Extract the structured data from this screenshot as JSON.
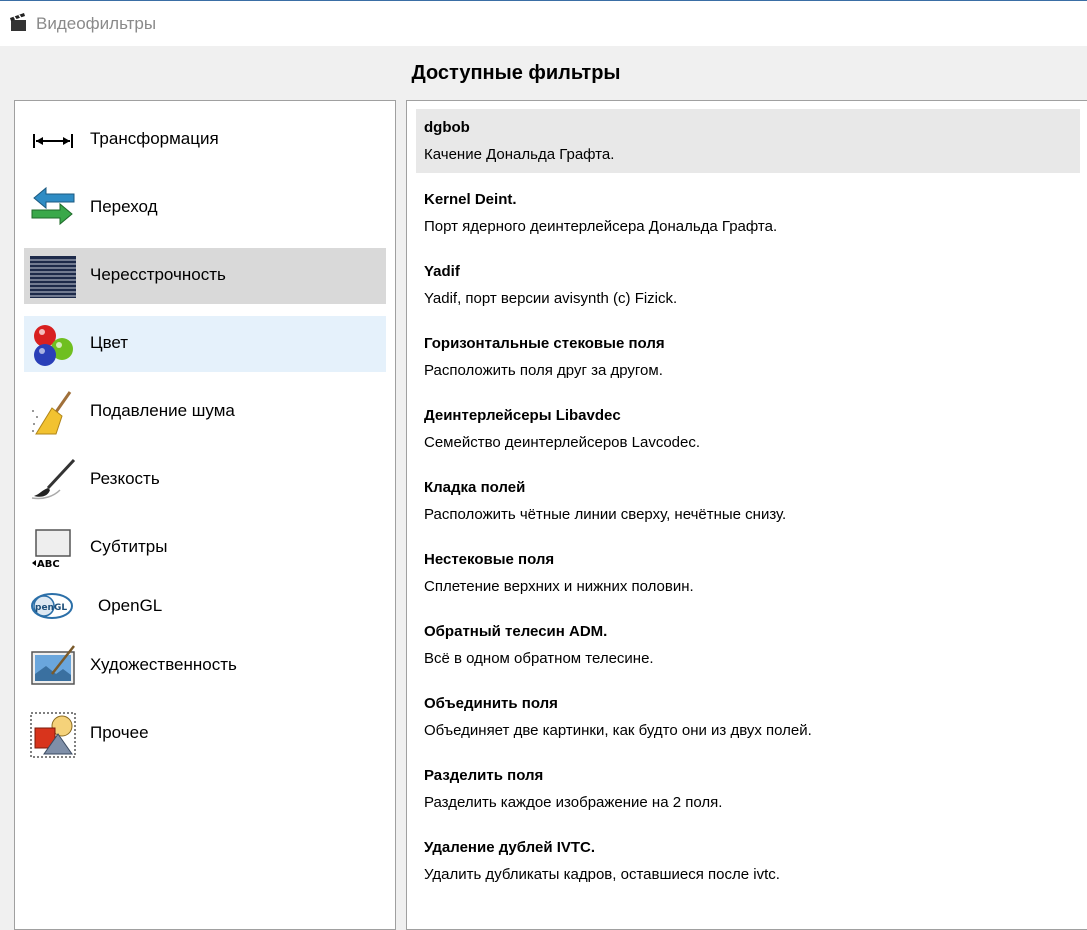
{
  "window": {
    "title": "Видеофильтры"
  },
  "heading": "Доступные фильтры",
  "categories": [
    {
      "label": "Трансформация",
      "icon": "transform-icon"
    },
    {
      "label": "Переход",
      "icon": "transition-arrows-icon"
    },
    {
      "label": "Чересстрочность",
      "icon": "interlace-lines-icon",
      "state": "selected"
    },
    {
      "label": "Цвет",
      "icon": "color-balls-icon",
      "state": "hover"
    },
    {
      "label": "Подавление шума",
      "icon": "broom-icon"
    },
    {
      "label": "Резкость",
      "icon": "brush-icon"
    },
    {
      "label": "Субтитры",
      "icon": "subtitles-icon"
    },
    {
      "label": "OpenGL",
      "icon": "opengl-icon"
    },
    {
      "label": "Художественность",
      "icon": "art-picture-icon"
    },
    {
      "label": "Прочее",
      "icon": "shapes-icon"
    }
  ],
  "filters": [
    {
      "name": "dgbob",
      "desc": "Качение Дональда Графта.",
      "state": "selected"
    },
    {
      "name": "Kernel Deint.",
      "desc": "Порт ядерного деинтерлейсера Дональда Графта."
    },
    {
      "name": "Yadif",
      "desc": "Yadif, порт версии avisynth (c) Fizick."
    },
    {
      "name": "Горизонтальные стековые поля",
      "desc": "Расположить поля друг за другом."
    },
    {
      "name": "Деинтерлейсеры Libavdec",
      "desc": "Семейство деинтерлейсеров Lavcodec."
    },
    {
      "name": "Кладка полей",
      "desc": "Расположить чётные линии сверху, нечётные снизу."
    },
    {
      "name": "Нестековые поля",
      "desc": "Сплетение верхних и нижних половин."
    },
    {
      "name": "Обратный телесин ADM.",
      "desc": "Всё в одном обратном телесине."
    },
    {
      "name": "Объединить поля",
      "desc": "Объединяет две картинки, как будто они из двух полей."
    },
    {
      "name": "Разделить поля",
      "desc": "Разделить каждое изображение на 2 поля."
    },
    {
      "name": "Удаление дублей IVTC.",
      "desc": "Удалить дубликаты кадров, оставшиеся после ivtc."
    }
  ]
}
